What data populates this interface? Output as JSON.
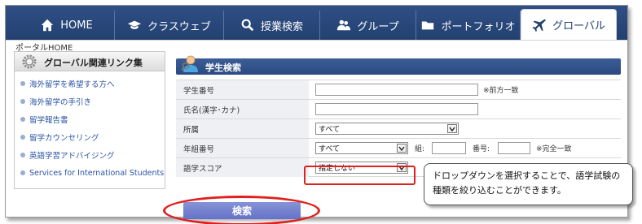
{
  "nav": {
    "tabs": [
      {
        "label": "HOME",
        "icon": "home-icon"
      },
      {
        "label": "クラスウェブ",
        "icon": "graduation-cap-icon"
      },
      {
        "label": "授業検索",
        "icon": "search-icon"
      },
      {
        "label": "グループ",
        "icon": "group-icon"
      },
      {
        "label": "ポートフォリオ",
        "icon": "folder-icon"
      },
      {
        "label": "グローバル",
        "icon": "airplane-icon",
        "active": true
      }
    ]
  },
  "breadcrumb": "ポータルHOME",
  "sidebar": {
    "title": "グローバル関連リンク集",
    "links": [
      "海外留学を希望する方へ",
      "海外留学の手引き",
      "留学報告書",
      "留学カウンセリング",
      "英語学習アドバイジング",
      "Services for International Students"
    ]
  },
  "panel": {
    "title": "学生検索",
    "fields": {
      "student_number": {
        "label": "学生番号",
        "value": "",
        "note": "※前方一致"
      },
      "name": {
        "label": "氏名(漢字･カナ)",
        "value": ""
      },
      "affiliation": {
        "label": "所属",
        "selected": "すべて"
      },
      "year_class": {
        "label": "年組番号",
        "selected": "すべて",
        "class_label": "組:",
        "number_label": "番号:",
        "note": "※完全一致"
      },
      "language_score": {
        "label": "語学スコア",
        "selected": "指定しない"
      }
    },
    "search_button": "検索"
  },
  "callout": "ドロップダウンを選択することで、語学試験の種類を絞り込むことができます。",
  "colors": {
    "nav_blue": "#2f4f86",
    "highlight_red": "#e0201c",
    "button_blue": "#6f7ecd"
  }
}
